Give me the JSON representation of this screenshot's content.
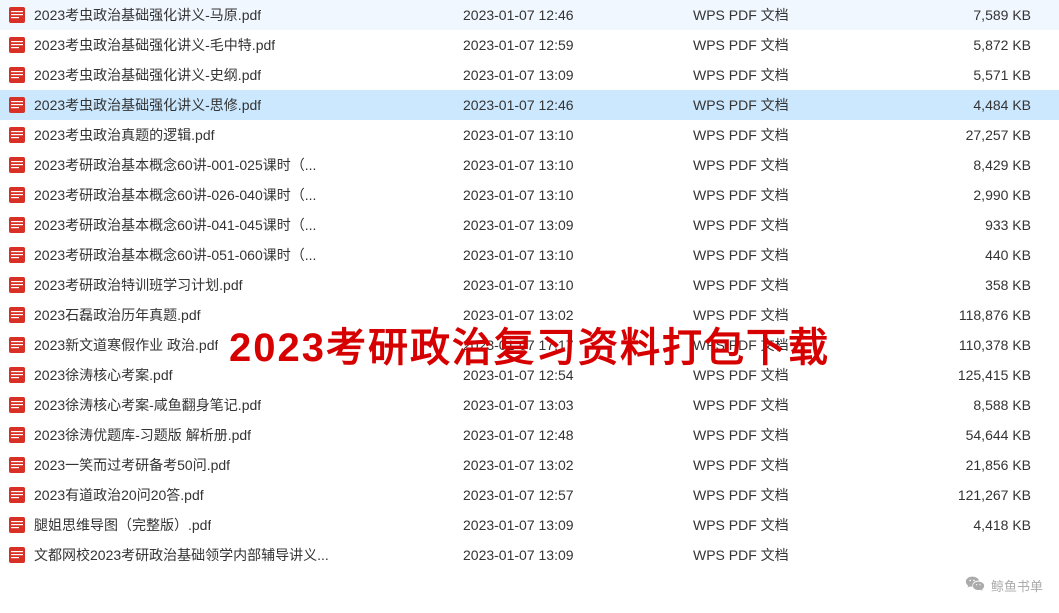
{
  "overlay_text": "2023考研政治复习资料打包下载",
  "watermark_text": "鲸鱼书单",
  "file_type_label": "WPS PDF 文档",
  "selected_index": 3,
  "files": [
    {
      "name": "2023考虫政治基础强化讲义-马原.pdf",
      "date": "2023-01-07 12:46",
      "size": "7,589 KB"
    },
    {
      "name": "2023考虫政治基础强化讲义-毛中特.pdf",
      "date": "2023-01-07 12:59",
      "size": "5,872 KB"
    },
    {
      "name": "2023考虫政治基础强化讲义-史纲.pdf",
      "date": "2023-01-07 13:09",
      "size": "5,571 KB"
    },
    {
      "name": "2023考虫政治基础强化讲义-思修.pdf",
      "date": "2023-01-07 12:46",
      "size": "4,484 KB"
    },
    {
      "name": "2023考虫政治真题的逻辑.pdf",
      "date": "2023-01-07 13:10",
      "size": "27,257 KB"
    },
    {
      "name": "2023考研政治基本概念60讲-001-025课时（...",
      "date": "2023-01-07 13:10",
      "size": "8,429 KB"
    },
    {
      "name": "2023考研政治基本概念60讲-026-040课时（...",
      "date": "2023-01-07 13:10",
      "size": "2,990 KB"
    },
    {
      "name": "2023考研政治基本概念60讲-041-045课时（...",
      "date": "2023-01-07 13:09",
      "size": "933 KB"
    },
    {
      "name": "2023考研政治基本概念60讲-051-060课时（...",
      "date": "2023-01-07 13:10",
      "size": "440 KB"
    },
    {
      "name": "2023考研政治特训班学习计划.pdf",
      "date": "2023-01-07 13:10",
      "size": "358 KB"
    },
    {
      "name": "2023石磊政治历年真题.pdf",
      "date": "2023-01-07 13:02",
      "size": "118,876 KB"
    },
    {
      "name": "2023新文道寒假作业 政治.pdf",
      "date": "2023-01-07 17:17",
      "size": "110,378 KB"
    },
    {
      "name": "2023徐涛核心考案.pdf",
      "date": "2023-01-07 12:54",
      "size": "125,415 KB"
    },
    {
      "name": "2023徐涛核心考案-咸鱼翻身笔记.pdf",
      "date": "2023-01-07 13:03",
      "size": "8,588 KB"
    },
    {
      "name": "2023徐涛优题库-习题版 解析册.pdf",
      "date": "2023-01-07 12:48",
      "size": "54,644 KB"
    },
    {
      "name": "2023一笑而过考研备考50问.pdf",
      "date": "2023-01-07 13:02",
      "size": "21,856 KB"
    },
    {
      "name": "2023有道政治20问20答.pdf",
      "date": "2023-01-07 12:57",
      "size": "121,267 KB"
    },
    {
      "name": "腿姐思维导图（完整版）.pdf",
      "date": "2023-01-07 13:09",
      "size": "4,418 KB"
    },
    {
      "name": "文都网校2023考研政治基础领学内部辅导讲义...",
      "date": "2023-01-07 13:09",
      "size": ""
    }
  ]
}
